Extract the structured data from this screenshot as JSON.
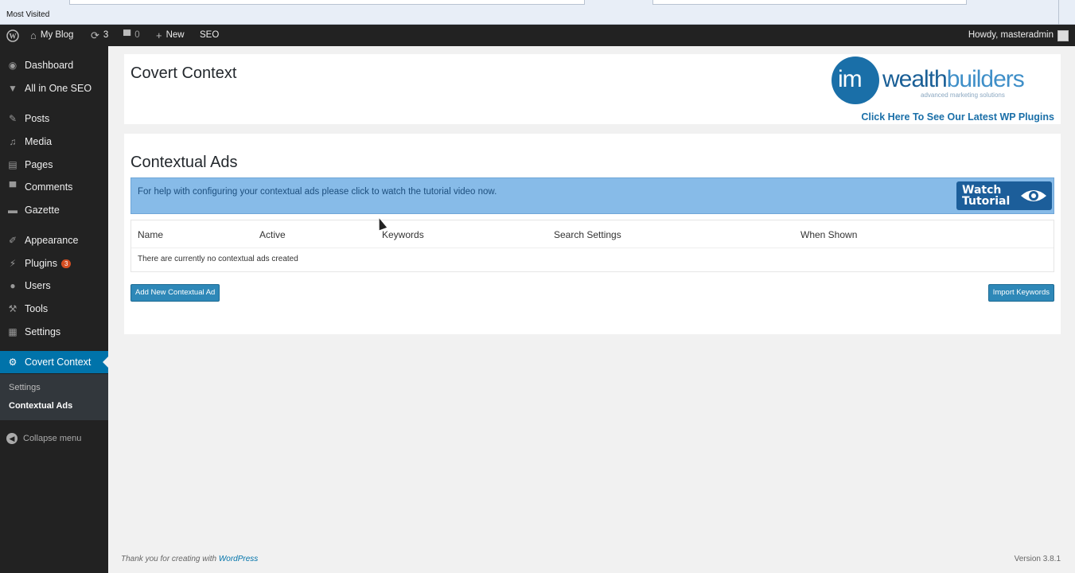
{
  "browser": {
    "bookmark": "Most Visited"
  },
  "adminbar": {
    "site_name": "My Blog",
    "updates_count": "3",
    "comments_count": "0",
    "new_label": "New",
    "seo_label": "SEO",
    "howdy": "Howdy, masteradmin"
  },
  "sidebar": {
    "items": [
      {
        "label": "Dashboard"
      },
      {
        "label": "All in One SEO"
      },
      {
        "label": "Posts"
      },
      {
        "label": "Media"
      },
      {
        "label": "Pages"
      },
      {
        "label": "Comments"
      },
      {
        "label": "Gazette"
      },
      {
        "label": "Appearance"
      },
      {
        "label": "Plugins",
        "badge": "3"
      },
      {
        "label": "Users"
      },
      {
        "label": "Tools"
      },
      {
        "label": "Settings"
      },
      {
        "label": "Covert Context"
      }
    ],
    "submenu": [
      "Settings",
      "Contextual Ads"
    ],
    "collapse": "Collapse menu"
  },
  "header": {
    "title": "Covert Context",
    "logo_im": "im",
    "logo_wealth": "wealth",
    "logo_builders": "builders",
    "logo_tagline": "advanced marketing solutions",
    "plugins_link": "Click Here To See Our Latest WP Plugins"
  },
  "main": {
    "title": "Contextual Ads",
    "help_text": "For help with configuring your contextual ads please click to watch the tutorial video now.",
    "watch_line1": "Watch",
    "watch_line2": "Tutorial",
    "columns": [
      "Name",
      "Active",
      "Keywords",
      "Search Settings",
      "When Shown"
    ],
    "empty_message": "There are currently no contextual ads created",
    "add_button": "Add New Contextual Ad",
    "import_button": "Import Keywords"
  },
  "footer": {
    "thanks_prefix": "Thank you for creating with",
    "thanks_link": "WordPress",
    "version": "Version 3.8.1"
  },
  "colors": {
    "accent": "#0073aa",
    "adminbar": "#222222",
    "help_bar": "#87bbe8",
    "button": "#2e88b8"
  }
}
